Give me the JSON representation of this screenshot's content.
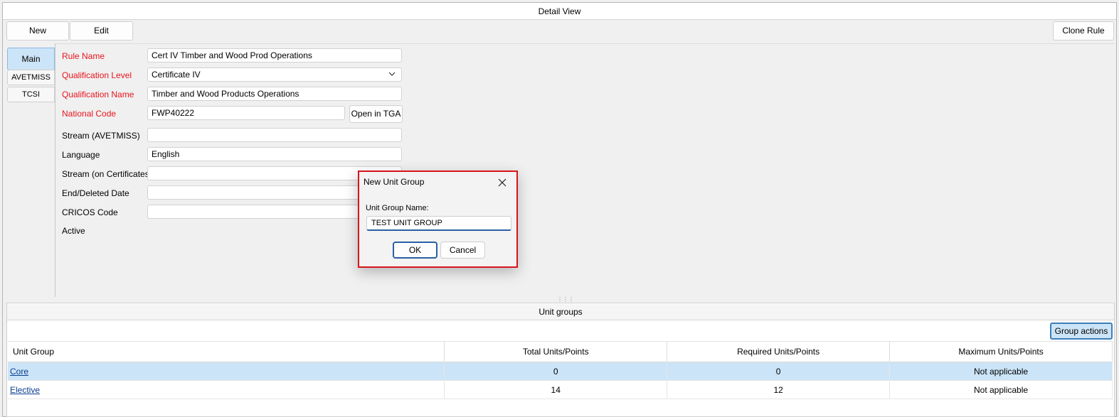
{
  "window": {
    "title": "Detail View"
  },
  "toolbar": {
    "new_label": "New",
    "edit_label": "Edit",
    "clone_label": "Clone Rule"
  },
  "side_tabs": [
    {
      "label": "Main"
    },
    {
      "label": "AVETMISS"
    },
    {
      "label": "TCSI"
    }
  ],
  "form": {
    "rule_name": {
      "label": "Rule Name",
      "value": "Cert IV Timber and Wood Prod Operations"
    },
    "qualification_level": {
      "label": "Qualification Level",
      "value": "Certificate IV"
    },
    "qualification_name": {
      "label": "Qualification Name",
      "value": "Timber and Wood Products Operations"
    },
    "national_code": {
      "label": "National Code",
      "value": "FWP40222",
      "button": "Open in TGA"
    },
    "stream_avetmiss": {
      "label": "Stream (AVETMISS)",
      "value": ""
    },
    "language": {
      "label": "Language",
      "value": "English"
    },
    "stream_certificates": {
      "label": "Stream (on Certificates)",
      "value": ""
    },
    "end_deleted_date": {
      "label": "End/Deleted Date",
      "value": ""
    },
    "cricos_code": {
      "label": "CRICOS Code",
      "value": ""
    },
    "active": {
      "label": "Active"
    }
  },
  "unit_groups": {
    "header": "Unit groups",
    "group_actions_label": "Group actions",
    "columns": [
      "Unit Group",
      "Total Units/Points",
      "Required Units/Points",
      "Maximum Units/Points"
    ],
    "rows": [
      {
        "name": "Core",
        "total": "0",
        "required": "0",
        "maximum": "Not applicable"
      },
      {
        "name": "Elective",
        "total": "14",
        "required": "12",
        "maximum": "Not applicable"
      }
    ]
  },
  "dialog": {
    "title": "New Unit Group",
    "field_label": "Unit Group Name:",
    "field_value": "TEST UNIT GROUP",
    "ok_label": "OK",
    "cancel_label": "Cancel"
  },
  "colors": {
    "required_label": "#e8141d",
    "selection": "#cce4f7",
    "dialog_border": "#d9141b",
    "focus_blue": "#2b5fa5"
  }
}
